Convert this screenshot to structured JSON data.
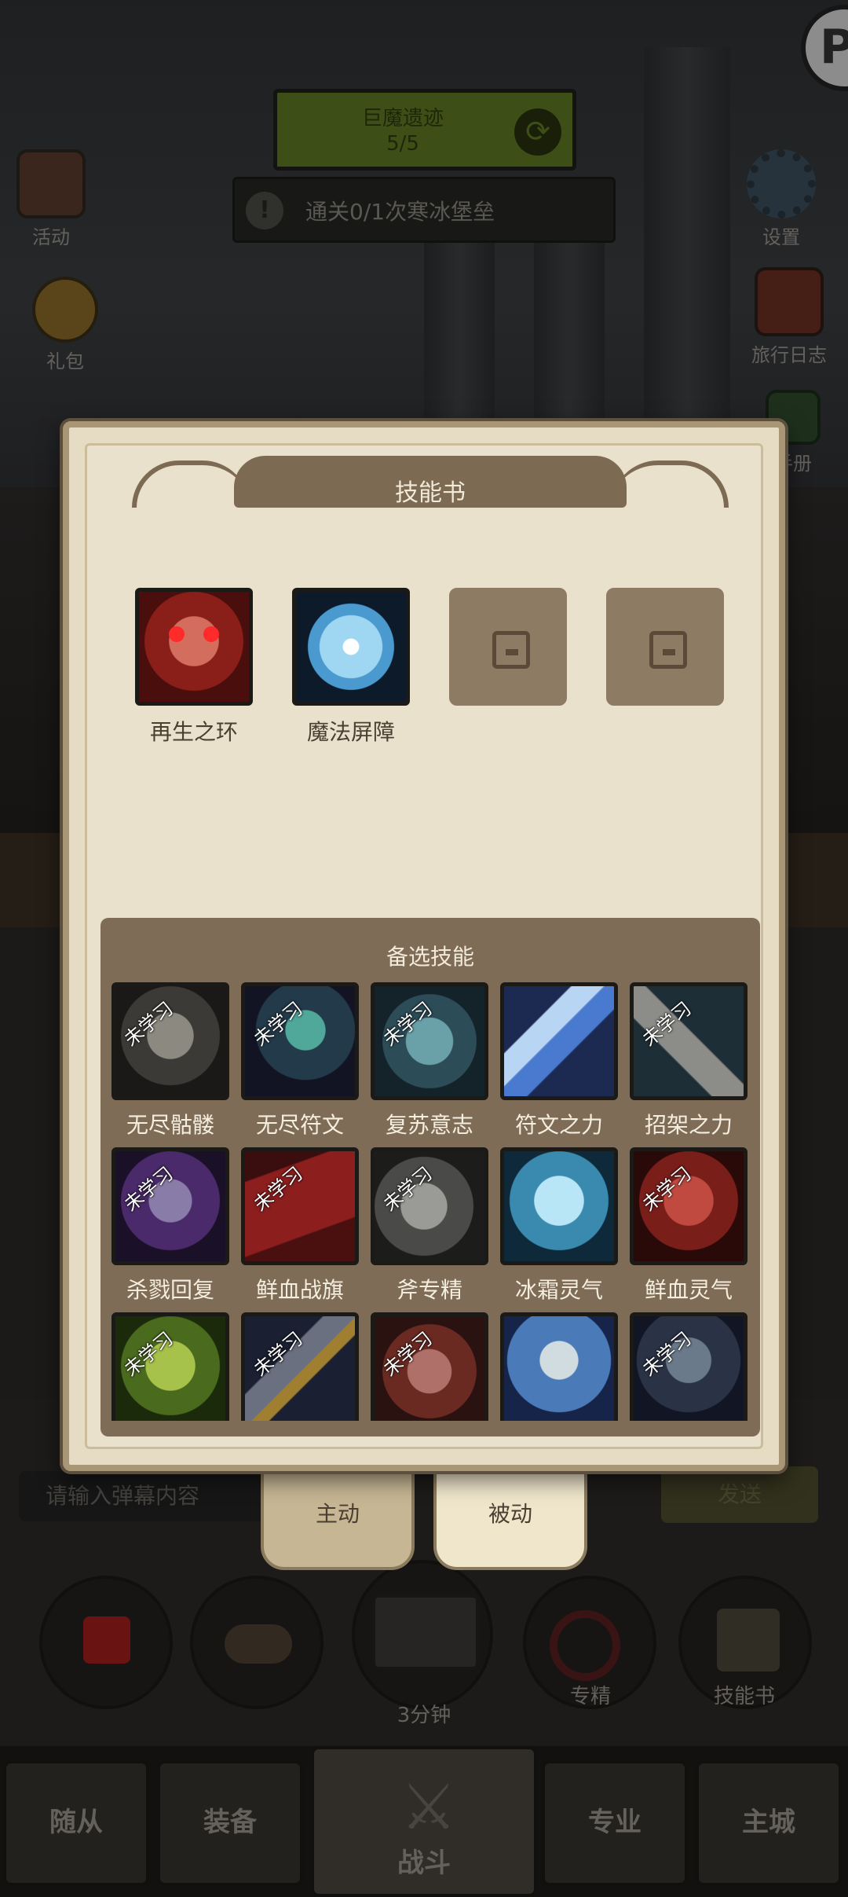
{
  "stage": {
    "name": "巨魔遗迹",
    "progress": "5/5"
  },
  "quest": {
    "text": "通关0/1次寒冰堡垒"
  },
  "left_icons": [
    {
      "label": "活动",
      "icon": "scroll-board-icon"
    },
    {
      "label": "礼包",
      "icon": "gold-coin-icon"
    }
  ],
  "right_icons": [
    {
      "label": "设置",
      "icon": "gear-icon"
    },
    {
      "label": "旅行日志",
      "icon": "journal-icon"
    },
    {
      "label": "手册",
      "icon": "manual-icon"
    }
  ],
  "badge_letter": "P",
  "skillbook": {
    "title": "技能书",
    "equipped": [
      {
        "name": "再生之环",
        "icon": "red-skull-icon"
      },
      {
        "name": "魔法屏障",
        "icon": "ice-shield-icon"
      },
      {
        "name": "",
        "icon": "locked-slot-icon"
      },
      {
        "name": "",
        "icon": "locked-slot-icon"
      }
    ],
    "reserve_title": "备选技能",
    "unlearned_label": "未学习",
    "reserve": [
      {
        "name": "无尽骷髅",
        "learned": false,
        "icon": "skeleton-icon"
      },
      {
        "name": "无尽符文",
        "learned": false,
        "icon": "endless-rune-icon"
      },
      {
        "name": "复苏意志",
        "learned": false,
        "icon": "revival-fist-icon"
      },
      {
        "name": "符文之力",
        "learned": true,
        "icon": "rune-blade-icon"
      },
      {
        "name": "招架之力",
        "learned": false,
        "icon": "parry-axe-icon"
      },
      {
        "name": "杀戮回复",
        "learned": false,
        "icon": "purple-reaper-icon"
      },
      {
        "name": "鲜血战旗",
        "learned": false,
        "icon": "blood-banner-icon"
      },
      {
        "name": "斧专精",
        "learned": false,
        "icon": "axe-mastery-icon"
      },
      {
        "name": "冰霜灵气",
        "learned": true,
        "icon": "frost-skull-icon"
      },
      {
        "name": "鲜血灵气",
        "learned": false,
        "icon": "blood-skull-icon"
      },
      {
        "name": "",
        "learned": false,
        "icon": "green-skull-icon"
      },
      {
        "name": "",
        "learned": false,
        "icon": "sword-icon"
      },
      {
        "name": "",
        "learned": false,
        "icon": "demon-icon"
      },
      {
        "name": "",
        "learned": true,
        "icon": "bone-armor-icon"
      },
      {
        "name": "",
        "learned": false,
        "icon": "ghoul-icon"
      }
    ]
  },
  "tabs": {
    "active_tab": "主动",
    "passive_tab": "被动"
  },
  "chat": {
    "placeholder": "请输入弹幕内容",
    "send": "发送"
  },
  "actions": {
    "chest_timer": "3分钟",
    "specialize": "专精",
    "skillbook": "技能书"
  },
  "nav": [
    "随从",
    "装备",
    "战斗",
    "专业",
    "主城"
  ]
}
